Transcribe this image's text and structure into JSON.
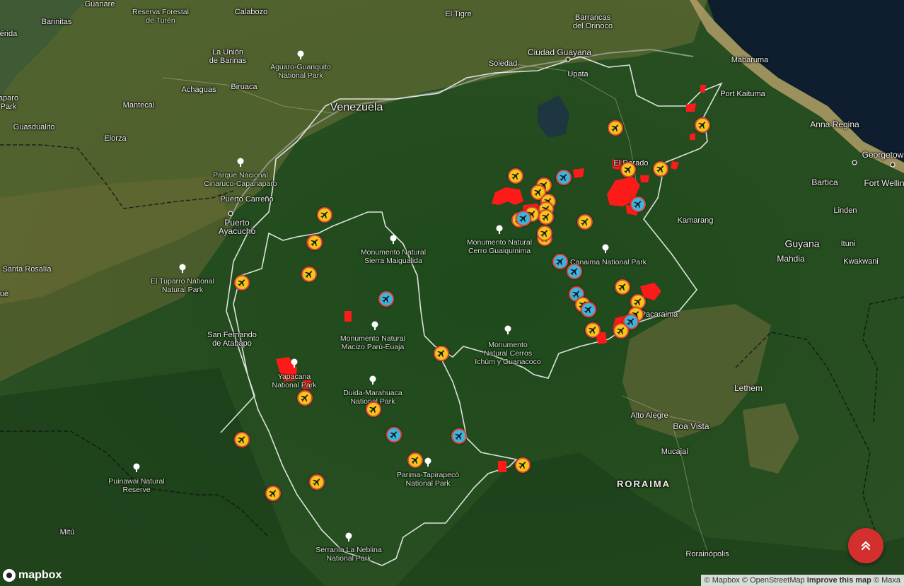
{
  "colors": {
    "yellow_marker": "#f5c518",
    "blue_marker": "#3cb4e0",
    "marker_ring": "#e2453b",
    "fire_red": "#ff1a1a",
    "fab": "#d32f2f"
  },
  "icons": {
    "marker": "airplane-icon",
    "park": "tree-icon",
    "fab": "double-chevron-up-icon"
  },
  "labels": {
    "guanare": "Guanare",
    "barinitas": "Barinitas",
    "reserva_forestal": "Reserva Forestal\nde Turén",
    "calabozo": "Calabozo",
    "el_tigre": "El Tigre",
    "barrancas": "Barrancas\ndel Orinoco",
    "merida": "érida",
    "la_union": "La Unión\nde Barinas",
    "aguaro": "Aguaro-Guariquito\nNational Park",
    "soledad": "Soledad",
    "ciudad_guayana": "Ciudad Guayana",
    "upata": "Upata",
    "mabaruma": "Mabaruma",
    "paro": "aparo\nPark",
    "achaguas": "Achaguas",
    "biruaca": "Biruaca",
    "venezuela": "Venezuela",
    "port_kaituma": "Port Kaituma",
    "mantecal": "Mantecal",
    "guasdualito": "Guasdualito",
    "elorza": "Elorza",
    "anna_regina": "Anna Regina",
    "georgetown": "Georgetow",
    "el_dorado": "El Dorado",
    "cinaruco": "Parque Nacional\nCinaruco-Capanaparo",
    "puerto_carreno": "Puerto Carreño",
    "bartica": "Bartica",
    "fort_wellington": "Fort Wellin",
    "puerto_ayacucho": "Puerto\nAyacucho",
    "linden": "Linden",
    "kamarang": "Kamarang",
    "guaiquinima": "Monumento Natural\nCerro Guaiquinima",
    "sierra_maigualida": "Monumento Natural\nSierra Maigualida",
    "guyana": "Guyana",
    "ituni": "Ituni",
    "mahdia": "Mahdia",
    "canaima": "Canaima National Park",
    "kwakwani": "Kwakwani",
    "santa_rosalia": "Santa Rosalía",
    "tuparro": "El Tuparro National\nNatural Park",
    "que": "ué",
    "pacaraima": "Pacaraima",
    "san_fernando": "San Fernando\nde Atabapo",
    "paru_euaja": "Monumento Natural\nMacizo Parú-Euaja",
    "ichum": "Monumento\nNatural Cerros\nIchúm y Guanacoco",
    "yapacana": "Yapacana\nNational Park",
    "duida": "Duida-Marahuaca\nNational Park",
    "lethem": "Lethem",
    "alto_alegre": "Alto Alegre",
    "boa_vista": "Boa Vista",
    "mucajai": "Mucajaí",
    "parima": "Parima-Tapirapecó\nNational Park",
    "puinawai": "Puinawai Natural\nReserve",
    "roraima": "RORAIMA",
    "mitu": "Mitú",
    "neblina": "Serranía La Neblina\nNational Park",
    "rorainopolis": "Rorainópolis"
  },
  "markers": [
    {
      "type": "yellow"
    },
    {
      "type": "yellow"
    },
    {
      "type": "blue"
    },
    {
      "type": "yellow"
    },
    {
      "type": "yellow"
    },
    {
      "type": "yellow"
    },
    {
      "type": "yellow"
    },
    {
      "type": "yellow"
    },
    {
      "type": "blue"
    },
    {
      "type": "yellow"
    },
    {
      "type": "yellow"
    },
    {
      "type": "yellow"
    },
    {
      "type": "yellow"
    },
    {
      "type": "yellow"
    },
    {
      "type": "yellow"
    },
    {
      "type": "blue"
    },
    {
      "type": "yellow"
    },
    {
      "type": "yellow"
    },
    {
      "type": "yellow"
    },
    {
      "type": "yellow"
    },
    {
      "type": "yellow"
    },
    {
      "type": "blue"
    },
    {
      "type": "yellow"
    },
    {
      "type": "yellow"
    },
    {
      "type": "blue"
    },
    {
      "type": "blue"
    },
    {
      "type": "yellow"
    },
    {
      "type": "blue"
    },
    {
      "type": "yellow"
    },
    {
      "type": "blue"
    },
    {
      "type": "blue"
    },
    {
      "type": "yellow"
    },
    {
      "type": "yellow"
    },
    {
      "type": "blue"
    },
    {
      "type": "yellow"
    },
    {
      "type": "yellow"
    },
    {
      "type": "yellow"
    },
    {
      "type": "blue"
    },
    {
      "type": "yellow"
    },
    {
      "type": "yellow"
    },
    {
      "type": "yellow"
    },
    {
      "type": "yellow"
    },
    {
      "type": "yellow"
    },
    {
      "type": "yellow"
    },
    {
      "type": "yellow"
    }
  ],
  "footer": {
    "logo_text": "mapbox",
    "attr_mapbox": "© Mapbox",
    "attr_osm": "© OpenStreetMap",
    "attr_improve": "Improve this map",
    "attr_maxar": "© Maxa"
  }
}
